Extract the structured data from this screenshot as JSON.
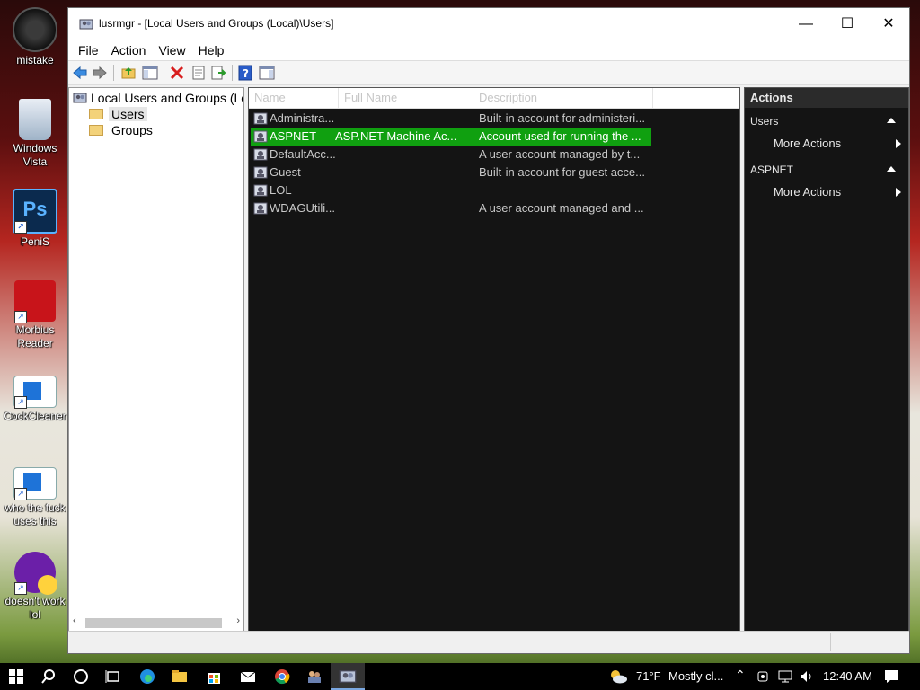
{
  "desktop": {
    "icons": [
      {
        "label": "mistake"
      },
      {
        "label": "Windows Vista"
      },
      {
        "label": "PeniS"
      },
      {
        "label": "Morbius Reader"
      },
      {
        "label": "CockCleaner"
      },
      {
        "label": "who the fuck uses this"
      },
      {
        "label": "doesn't work lol"
      }
    ]
  },
  "window": {
    "title": "lusrmgr - [Local Users and Groups (Local)\\Users]",
    "minimize": "—",
    "maximize": "☐",
    "close": "✕"
  },
  "menu": [
    "File",
    "Action",
    "View",
    "Help"
  ],
  "tree": {
    "root": "Local Users and Groups (Local)",
    "children": [
      "Users",
      "Groups"
    ],
    "selected": "Users"
  },
  "list": {
    "columns": [
      "Name",
      "Full Name",
      "Description"
    ],
    "rows": [
      {
        "name": "Administra...",
        "full_name": "",
        "description": "Built-in account for administeri..."
      },
      {
        "name": "ASPNET",
        "full_name": "ASP.NET Machine Ac...",
        "description": "Account used for running the ..."
      },
      {
        "name": "DefaultAcc...",
        "full_name": "",
        "description": "A user account managed by t..."
      },
      {
        "name": "Guest",
        "full_name": "",
        "description": "Built-in account for guest acce..."
      },
      {
        "name": "LOL",
        "full_name": "",
        "description": ""
      },
      {
        "name": "WDAGUtili...",
        "full_name": "",
        "description": "A user account managed and ..."
      }
    ],
    "selected_row": "ASPNET"
  },
  "actions": {
    "header": "Actions",
    "sections": [
      {
        "title": "Users",
        "item": "More Actions"
      },
      {
        "title": "ASPNET",
        "item": "More Actions"
      }
    ]
  },
  "taskbar": {
    "weather_temp": "71°F",
    "weather_desc": "Mostly cl...",
    "time": "12:40 AM"
  },
  "colors": {
    "selection": "#10a010",
    "list_bg": "#141414",
    "taskbar": "#000000"
  }
}
